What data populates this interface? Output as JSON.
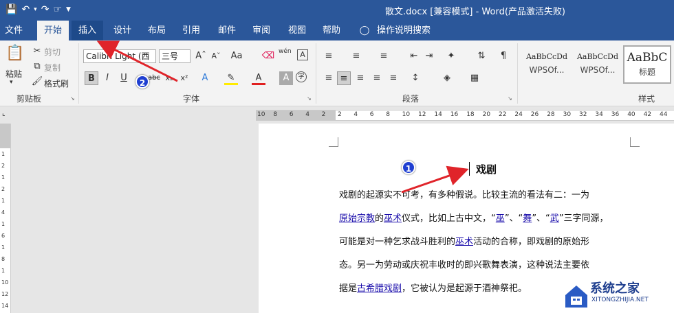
{
  "titlebar": {
    "title": "散文.docx [兼容模式] - Word(产品激活失败)",
    "qat_icons": [
      "save-icon",
      "undo-icon",
      "redo-icon",
      "touch-mode-icon",
      "customize-icon"
    ]
  },
  "tabs": [
    {
      "label": "文件"
    },
    {
      "label": "开始"
    },
    {
      "label": "插入"
    },
    {
      "label": "设计"
    },
    {
      "label": "布局"
    },
    {
      "label": "引用"
    },
    {
      "label": "邮件"
    },
    {
      "label": "审阅"
    },
    {
      "label": "视图"
    },
    {
      "label": "帮助"
    },
    {
      "label": "操作说明搜索"
    }
  ],
  "clipboard": {
    "paste": "粘贴",
    "cut": "剪切",
    "copy": "复制",
    "format_painter": "格式刷",
    "group": "剪贴板"
  },
  "font": {
    "name": "Calibri Light (西",
    "size": "三号",
    "group": "字体",
    "pinyin": "wén"
  },
  "paragraph": {
    "group": "段落"
  },
  "styles": {
    "group": "样式",
    "items": [
      {
        "preview": "AaBbCcDd",
        "name": "WPSOf..."
      },
      {
        "preview": "AaBbCcDd",
        "name": "WPSOf..."
      },
      {
        "preview": "AaBbC",
        "name": "标题"
      }
    ]
  },
  "ruler": {
    "h_numbers": [
      "10",
      "8",
      "6",
      "4",
      "2",
      "2",
      "4",
      "6",
      "8",
      "10",
      "12",
      "14",
      "16",
      "18",
      "20",
      "22",
      "24",
      "26",
      "28",
      "30",
      "32",
      "34",
      "36",
      "40",
      "42",
      "44"
    ],
    "v_numbers": [
      "1",
      "2",
      "1",
      "2",
      "1",
      "4",
      "1",
      "6",
      "1",
      "8",
      "1",
      "10",
      "12",
      "14"
    ]
  },
  "document": {
    "title": "戏剧",
    "lines": [
      [
        {
          "t": "戏剧的起源实不可考，有多种假说。比较主流的看法有二：一为"
        }
      ],
      [
        {
          "t": "原始宗教",
          "link": true
        },
        {
          "t": "的"
        },
        {
          "t": "巫术",
          "link": true
        },
        {
          "t": "仪式，比如上古中文，“"
        },
        {
          "t": "巫",
          "link": true
        },
        {
          "t": "”、“"
        },
        {
          "t": "舞",
          "link": true
        },
        {
          "t": "”、“"
        },
        {
          "t": "武",
          "link": true
        },
        {
          "t": "”三字同源，"
        }
      ],
      [
        {
          "t": "可能是对一种乞求战斗胜利的"
        },
        {
          "t": "巫术",
          "link": true
        },
        {
          "t": "活动的合称，即戏剧的原始形"
        }
      ],
      [
        {
          "t": "态。另一为劳动或庆祝丰收时的即兴歌舞表演，这种说法主要依"
        }
      ],
      [
        {
          "t": "据是"
        },
        {
          "t": "古希腊戏剧",
          "link": true
        },
        {
          "t": "，它被认为是起源于酒神祭祀。"
        }
      ]
    ]
  },
  "annotations": {
    "badge1": "1",
    "badge2": "2",
    "color": "#e0242a"
  },
  "watermark": {
    "title": "系统之家",
    "subtitle": "XITONGZHIJIA.NET"
  }
}
